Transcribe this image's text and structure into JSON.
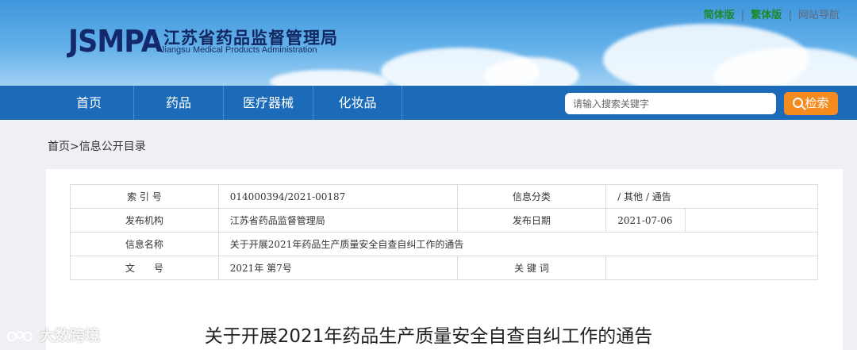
{
  "header": {
    "logo_mark": "JSMPA",
    "logo_cn": "江苏省药品监督管理局",
    "logo_en": "Jiangsu Medical Products Administration",
    "top_links": [
      "简体版",
      "繁体版",
      "网站导航"
    ],
    "separator": "|"
  },
  "nav": {
    "items": [
      "首页",
      "药品",
      "医疗器械",
      "化妆品"
    ],
    "search_placeholder": "请输入搜索关键字",
    "search_button": "检索"
  },
  "breadcrumb": "首页>信息公开目录",
  "meta": {
    "rows": [
      {
        "label1": "索 引 号",
        "value1": "014000394/2021-00187",
        "label2": "信息分类",
        "value2": "/ 其他 / 通告"
      },
      {
        "label1": "发布机构",
        "value1": "江苏省药品监督管理局",
        "label2": "发布日期",
        "value2": "2021-07-06"
      },
      {
        "label1": "信息名称",
        "value1": "关于开展2021年药品生产质量安全自查自纠工作的通告"
      },
      {
        "label1": "文　　号",
        "value1": "2021年 第7号",
        "label2": "关 键 词",
        "value2": ""
      }
    ]
  },
  "article": {
    "title": "关于开展2021年药品生产质量安全自查自纠工作的通告"
  },
  "watermark": {
    "text": "大数跨境"
  },
  "colors": {
    "nav_bg": "#1b6bb8",
    "search_button": "#f58a1e",
    "logo": "#13296b"
  }
}
